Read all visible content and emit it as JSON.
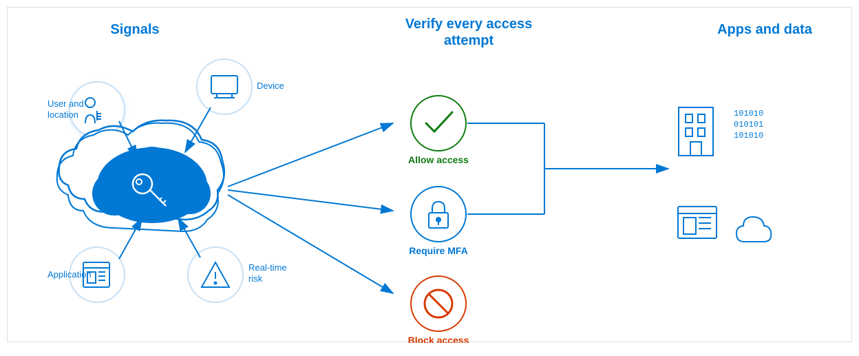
{
  "sections": {
    "signals": {
      "title": "Signals",
      "items": [
        {
          "id": "user-location",
          "label": "User and\nlocation"
        },
        {
          "id": "device",
          "label": "Device"
        },
        {
          "id": "application",
          "label": "Application"
        },
        {
          "id": "realtime-risk",
          "label": "Real-time\nrisk"
        }
      ]
    },
    "verify": {
      "title": "Verify every access\nattempt",
      "outcomes": [
        {
          "id": "allow",
          "label": "Allow access",
          "color": "#107c10"
        },
        {
          "id": "mfa",
          "label": "Require MFA",
          "color": "#0078d4"
        },
        {
          "id": "block",
          "label": "Block access",
          "color": "#d83b01"
        }
      ]
    },
    "apps": {
      "title": "Apps and data",
      "items": [
        {
          "id": "building",
          "type": "building"
        },
        {
          "id": "data-grid",
          "type": "data"
        },
        {
          "id": "app-window",
          "type": "window"
        },
        {
          "id": "cloud-app",
          "type": "cloud"
        }
      ]
    }
  },
  "colors": {
    "blue": "#0078d4",
    "green": "#107c10",
    "orange": "#d83b01",
    "circle-border": "#c8e0f4"
  }
}
